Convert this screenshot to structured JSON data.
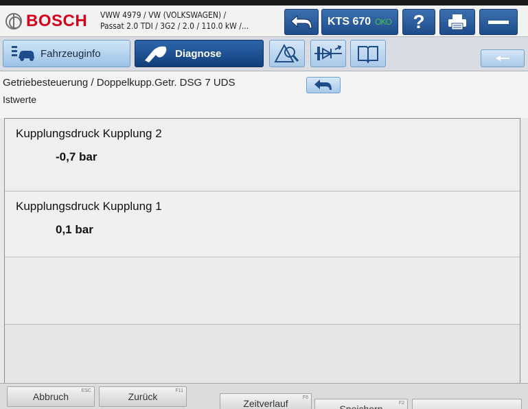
{
  "header": {
    "brand": "BOSCH",
    "vehicle_line1": "VWW 4979 / VW (VOLKSWAGEN) /",
    "vehicle_line2": "Passat 2.0 TDI / 3G2 / 2.0 / 110.0 kW /...",
    "device_name": "KTS 670",
    "device_status": "OKO",
    "help_label": "?"
  },
  "tabs": {
    "vehicle_info": "Fahrzeuginfo",
    "diagnosis": "Diagnose"
  },
  "breadcrumb": {
    "path": "Getriebesteuerung / Doppelkupp.Getr. DSG 7 UDS",
    "subtitle": "Istwerte"
  },
  "values": [
    {
      "name": "Kupplungsdruck Kupplung 2",
      "value": "-0,7 bar"
    },
    {
      "name": "Kupplungsdruck Kupplung 1",
      "value": "0,1 bar"
    }
  ],
  "footer": {
    "cancel": "Abbruch",
    "cancel_key": "ESC",
    "back": "Zurück",
    "back_key": "F11",
    "timeline": "Zeitverlauf",
    "timeline_key": "F6",
    "save": "Speichern",
    "save_key": "F2"
  },
  "colors": {
    "brand_red": "#d6001c",
    "accent_blue": "#1e4c8a",
    "status_green": "#48c34a"
  },
  "icons": {
    "back": "back-arrow-icon",
    "help": "question-icon",
    "print": "printer-icon",
    "minimize": "minimize-icon",
    "vehicle": "car-icon",
    "diagnosis": "diagnosis-plug-icon",
    "tool1": "warning-search-icon",
    "tool2": "measurement-icon",
    "tool3": "manual-book-icon"
  }
}
